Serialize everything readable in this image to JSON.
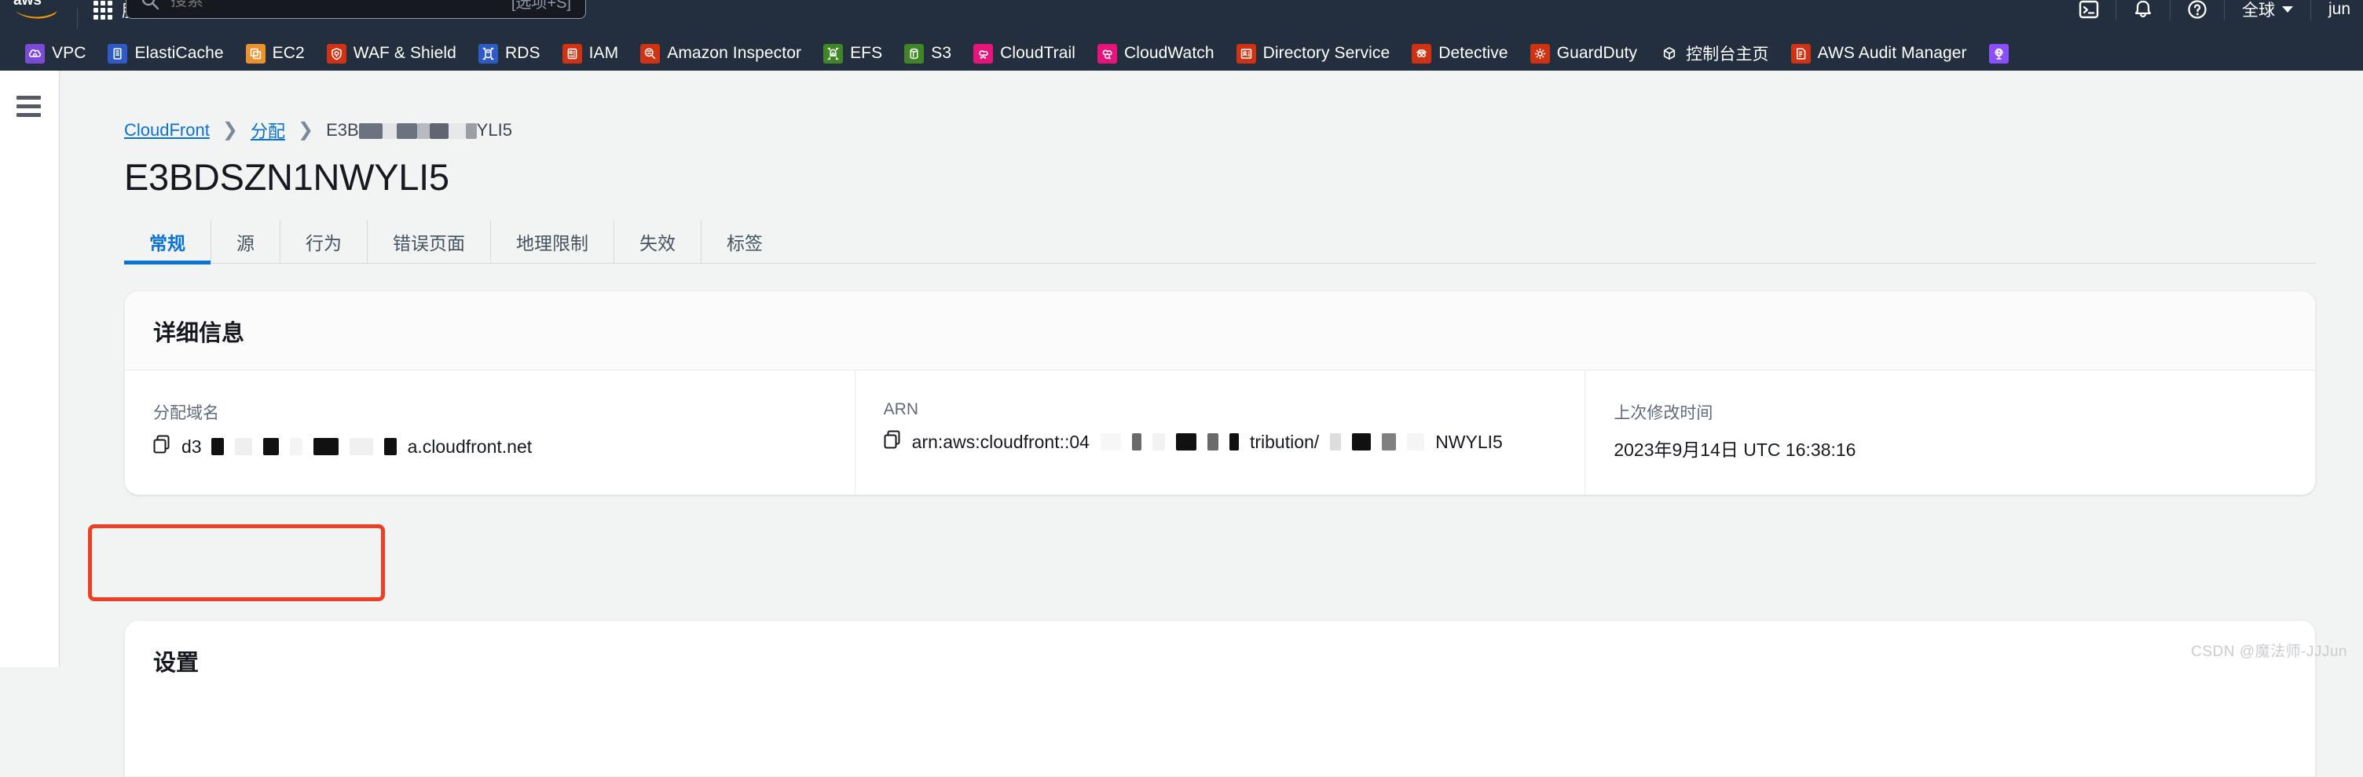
{
  "topnav": {
    "logo_alt": "aws-logo",
    "services_label": "服务",
    "search": {
      "placeholder": "搜索",
      "kbd_hint": "[选项+S]",
      "value": ""
    },
    "right_icons": [
      {
        "name": "cloudshell-icon",
        "glyph": "cloudshell"
      },
      {
        "name": "notifications-icon",
        "glyph": "bell"
      },
      {
        "name": "help-icon",
        "glyph": "question"
      }
    ],
    "region_label": "全球",
    "account_label": "jun"
  },
  "service_shortcuts": [
    {
      "label": "VPC",
      "color": "#7b4ad8",
      "icon": "vpc-icon"
    },
    {
      "label": "ElastiCache",
      "color": "#2f5cc4",
      "icon": "elasticache-icon"
    },
    {
      "label": "EC2",
      "color": "#ec912d",
      "icon": "ec2-icon"
    },
    {
      "label": "WAF & Shield",
      "color": "#d13212",
      "icon": "waf-shield-icon"
    },
    {
      "label": "RDS",
      "color": "#2f5cc4",
      "icon": "rds-icon"
    },
    {
      "label": "IAM",
      "color": "#d13212",
      "icon": "iam-icon"
    },
    {
      "label": "Amazon Inspector",
      "color": "#d13212",
      "icon": "inspector-icon"
    },
    {
      "label": "EFS",
      "color": "#3f8624",
      "icon": "efs-icon"
    },
    {
      "label": "S3",
      "color": "#3f8624",
      "icon": "s3-icon"
    },
    {
      "label": "CloudTrail",
      "color": "#e7157b",
      "icon": "cloudtrail-icon"
    },
    {
      "label": "CloudWatch",
      "color": "#e7157b",
      "icon": "cloudwatch-icon"
    },
    {
      "label": "Directory Service",
      "color": "#d13212",
      "icon": "directory-service-icon"
    },
    {
      "label": "Detective",
      "color": "#d13212",
      "icon": "detective-icon"
    },
    {
      "label": "GuardDuty",
      "color": "#d13212",
      "icon": "guardduty-icon"
    },
    {
      "label": "控制台主页",
      "color": "#232f3e",
      "icon": "console-home-icon"
    },
    {
      "label": "AWS Audit Manager",
      "color": "#d13212",
      "icon": "audit-manager-icon"
    },
    {
      "label": "",
      "color": "#8c4fff",
      "icon": "global-accelerator-icon"
    }
  ],
  "breadcrumb": {
    "items": [
      {
        "label": "CloudFront",
        "link": true
      },
      {
        "label": "分配",
        "link": true
      }
    ],
    "current_prefix": "E3B",
    "current_suffix": "YLI5"
  },
  "page_title": "E3BDSZN1NWYLI5",
  "tabs": [
    {
      "label": "常规",
      "active": true
    },
    {
      "label": "源",
      "active": false
    },
    {
      "label": "行为",
      "active": false
    },
    {
      "label": "错误页面",
      "active": false
    },
    {
      "label": "地理限制",
      "active": false
    },
    {
      "label": "失效",
      "active": false
    },
    {
      "label": "标签",
      "active": false
    }
  ],
  "details_card": {
    "title": "详细信息",
    "fields": [
      {
        "label": "分配域名",
        "value_prefix": "d3",
        "value_suffix": "a.cloudfront.net",
        "copyable": true,
        "highlighted": true
      },
      {
        "label": "ARN",
        "value_prefix": "arn:aws:cloudfront::04",
        "value_mid": "tribution/",
        "value_suffix": "NWYLI5",
        "copyable": true,
        "highlighted": false
      },
      {
        "label": "上次修改时间",
        "value_prefix": "2023年9月14日 UTC 16:38:16",
        "copyable": false,
        "highlighted": false
      }
    ]
  },
  "settings_card": {
    "title": "设置"
  },
  "watermark": "CSDN @魔法师-JJJun",
  "colors": {
    "nav_bg": "#232f3e",
    "page_bg": "#f2f3f3",
    "link": "#0972d3",
    "annotation": "#ee3f24"
  }
}
